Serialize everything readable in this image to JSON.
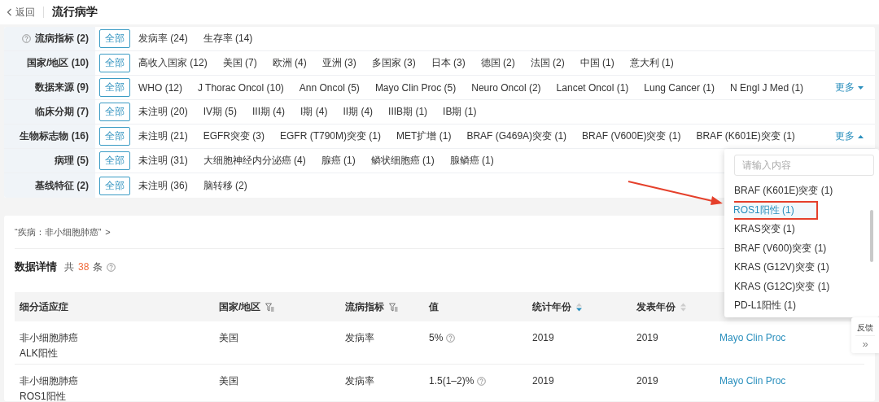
{
  "header": {
    "back": "返回",
    "title": "流行病学"
  },
  "filters": [
    {
      "label": "流病指标 (2)",
      "has_help": true,
      "all": {
        "label": "全部",
        "selected": true
      },
      "options": [
        "发病率 (24)",
        "生存率 (14)"
      ]
    },
    {
      "label": "国家/地区 (10)",
      "all": {
        "label": "全部",
        "selected": true
      },
      "options": [
        "高收入国家 (12)",
        "美国 (7)",
        "欧洲 (4)",
        "亚洲 (3)",
        "多国家 (3)",
        "日本 (3)",
        "德国 (2)",
        "法国 (2)",
        "中国 (1)",
        "意大利 (1)"
      ]
    },
    {
      "label": "数据来源 (9)",
      "all": {
        "label": "全部",
        "selected": true
      },
      "options": [
        "WHO (12)",
        "J Thorac Oncol (10)",
        "Ann Oncol (5)",
        "Mayo Clin Proc (5)",
        "Neuro Oncol (2)",
        "Lancet Oncol (1)",
        "Lung Cancer (1)",
        "N Engl J Med (1)"
      ],
      "more": {
        "label": "更多",
        "expanded": false
      }
    },
    {
      "label": "临床分期 (7)",
      "all": {
        "label": "全部",
        "selected": true
      },
      "options": [
        "未注明 (20)",
        "IV期 (5)",
        "III期 (4)",
        "I期 (4)",
        "II期 (4)",
        "IIIB期 (1)",
        "IB期 (1)"
      ]
    },
    {
      "label": "生物标志物 (16)",
      "all": {
        "label": "全部",
        "selected": true
      },
      "options": [
        "未注明 (21)",
        "EGFR突变 (3)",
        "EGFR (T790M)突变 (1)",
        "MET扩增 (1)",
        "BRAF (G469A)突变 (1)",
        "BRAF (V600E)突变 (1)",
        "BRAF (K601E)突变 (1)"
      ],
      "more": {
        "label": "更多",
        "expanded": true
      }
    },
    {
      "label": "病理 (5)",
      "all": {
        "label": "全部",
        "selected": true
      },
      "options": [
        "未注明 (31)",
        "大细胞神经内分泌癌 (4)",
        "腺癌 (1)",
        "鳞状细胞癌 (1)",
        "腺鳞癌 (1)"
      ]
    },
    {
      "label": "基线特征 (2)",
      "all": {
        "label": "全部",
        "selected": true
      },
      "options": [
        "未注明 (36)",
        "脑转移 (2)"
      ]
    }
  ],
  "dropdown": {
    "placeholder": "请输入内容",
    "items": [
      {
        "label": "BRAF (K601E)突变 (1)",
        "selected": false,
        "annotated": false
      },
      {
        "label": "ROS1阳性 (1)",
        "selected": true,
        "annotated": true
      },
      {
        "label": "KRAS突变 (1)",
        "selected": false,
        "annotated": false
      },
      {
        "label": "BRAF (V600)突变 (1)",
        "selected": false,
        "annotated": false
      },
      {
        "label": "KRAS (G12V)突变 (1)",
        "selected": false,
        "annotated": false
      },
      {
        "label": "KRAS (G12C)突变 (1)",
        "selected": false,
        "annotated": false
      },
      {
        "label": "PD-L1阳性 (1)",
        "selected": false,
        "annotated": false
      }
    ]
  },
  "card": {
    "breadcrumb": "“疾病：非小细胞肺癌”",
    "breadcrumb_arrow": ">",
    "title": "数据详情",
    "count_prefix": "共",
    "count": "38",
    "count_suffix": "条",
    "columns": [
      {
        "label": "细分适应症"
      },
      {
        "label": "国家/地区",
        "filter": true
      },
      {
        "label": "流病指标",
        "filter": true
      },
      {
        "label": "值"
      },
      {
        "label": "统计年份",
        "sorted": true
      },
      {
        "label": "发表年份",
        "sorted": false
      }
    ],
    "rows": [
      {
        "indication": "非小细胞肺癌\nALK阳性",
        "region": "美国",
        "metric": "发病率",
        "value": "5%",
        "value_help": true,
        "stat_year": "2019",
        "pub_year": "2019",
        "source": "Mayo Clin Proc"
      },
      {
        "indication": "非小细胞肺癌\nROS1阳性",
        "region": "美国",
        "metric": "发病率",
        "value": "1.5(1–2)%",
        "value_help": true,
        "stat_year": "2019",
        "pub_year": "2019",
        "source": "Mayo Clin Proc"
      }
    ]
  },
  "side": {
    "feedback": "反馈",
    "collapse": "»"
  }
}
